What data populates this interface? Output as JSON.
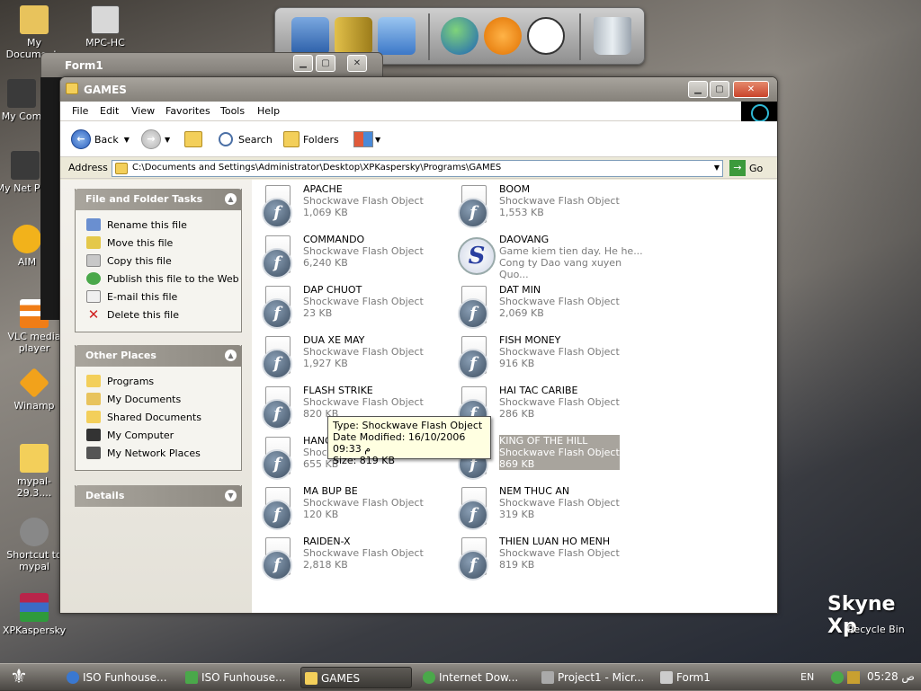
{
  "desktop": {
    "icons": [
      {
        "label": "My Documents",
        "icon": "my-documents-icon"
      },
      {
        "label": "MPC-HC",
        "icon": "mpc-hc-icon"
      },
      {
        "label": "My Com",
        "icon": "my-computer-icon"
      },
      {
        "label": "My Net Plac",
        "icon": "network-places-icon"
      },
      {
        "label": "AIM",
        "icon": "aim-icon"
      },
      {
        "label": "VLC media player",
        "icon": "vlc-icon"
      },
      {
        "label": "Winamp",
        "icon": "winamp-icon"
      },
      {
        "label": "mypal-29.3....",
        "icon": "folder-icon"
      },
      {
        "label": "Shortcut to mypal",
        "icon": "mypal-icon"
      },
      {
        "label": "XPKaspersky",
        "icon": "winrar-icon"
      },
      {
        "label": "Recycle Bin",
        "icon": "recycle-bin-icon"
      }
    ],
    "branding": "Skyne Xp"
  },
  "form1": {
    "title": "Form1"
  },
  "window": {
    "title": "GAMES",
    "menu": [
      "File",
      "Edit",
      "View",
      "Favorites",
      "Tools",
      "Help"
    ],
    "toolbar": {
      "back": "Back",
      "search": "Search",
      "folders": "Folders"
    },
    "address": {
      "label": "Address",
      "path": "C:\\Documents and Settings\\Administrator\\Desktop\\XPKaspersky\\Programs\\GAMES",
      "go": "Go"
    },
    "tasks": {
      "title": "File and Folder Tasks",
      "items": [
        "Rename this file",
        "Move this file",
        "Copy this file",
        "Publish this file to the Web",
        "E-mail this file",
        "Delete this file"
      ]
    },
    "places": {
      "title": "Other Places",
      "items": [
        "Programs",
        "My Documents",
        "Shared Documents",
        "My Computer",
        "My Network Places"
      ]
    },
    "details": {
      "title": "Details"
    },
    "files": [
      {
        "name": "APACHE",
        "type": "Shockwave Flash Object",
        "size": "1,069 KB"
      },
      {
        "name": "BOOM",
        "type": "Shockwave Flash Object",
        "size": "1,553 KB"
      },
      {
        "name": "COMMANDO",
        "type": "Shockwave Flash Object",
        "size": "6,240 KB"
      },
      {
        "name": "DAOVANG",
        "type": "Game kiem tien day. He he...",
        "size": "Cong ty Dao vang xuyen Quo..."
      },
      {
        "name": "DAP CHUOT",
        "type": "Shockwave Flash Object",
        "size": "23 KB"
      },
      {
        "name": "DAT MIN",
        "type": "Shockwave Flash Object",
        "size": "2,069 KB"
      },
      {
        "name": "DUA XE MAY",
        "type": "Shockwave Flash Object",
        "size": "1,927 KB"
      },
      {
        "name": "FISH MONEY",
        "type": "Shockwave Flash Object",
        "size": "916 KB"
      },
      {
        "name": "FLASH STRIKE",
        "type": "Shockwave Flash Object",
        "size": "820 KB"
      },
      {
        "name": "HAI TAC CARIBE",
        "type": "Shockwave Flash Object",
        "size": "286 KB"
      },
      {
        "name": "HANG",
        "type": "Shockwave Flash Object",
        "size": "655 KB"
      },
      {
        "name": "KING OF THE HILL",
        "type": "Shockwave Flash Object",
        "size": "869 KB"
      },
      {
        "name": "MA BUP BE",
        "type": "Shockwave Flash Object",
        "size": "120 KB"
      },
      {
        "name": "NEM THUC AN",
        "type": "Shockwave Flash Object",
        "size": "319 KB"
      },
      {
        "name": "RAIDEN-X",
        "type": "Shockwave Flash Object",
        "size": "2,818 KB"
      },
      {
        "name": "THIEN LUAN HO MENH",
        "type": "Shockwave Flash Object",
        "size": "819 KB"
      }
    ],
    "tooltip": {
      "line1": "Type: Shockwave Flash Object",
      "line2": "Date Modified: 16/10/2006 09:33 م",
      "line3": "Size: 819 KB"
    }
  },
  "taskbar": {
    "buttons": [
      "ISO Funhouse...",
      "ISO Funhouse...",
      "GAMES",
      "Internet Dow...",
      "Project1 - Micr...",
      "Form1"
    ],
    "lang": "EN",
    "clock": "05:28 ص"
  }
}
